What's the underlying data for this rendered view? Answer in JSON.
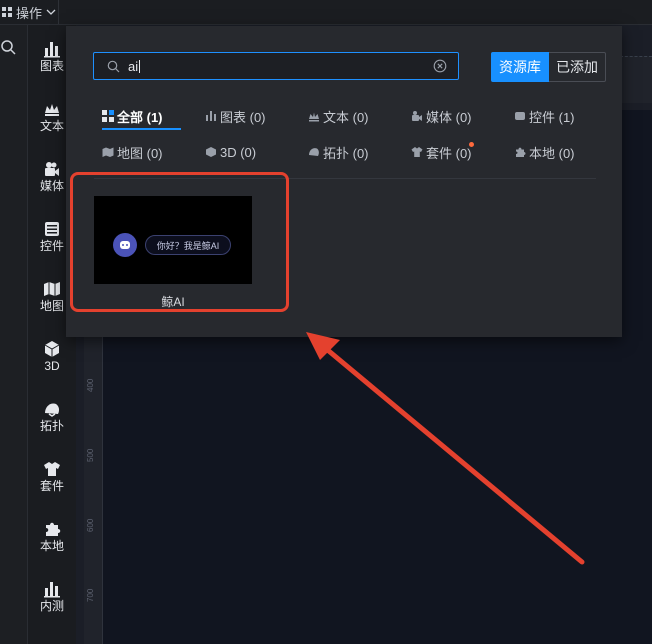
{
  "topbar": {
    "menu_label": "操作"
  },
  "rail": {
    "items": [
      {
        "label": "图表",
        "icon": "bar-chart-icon"
      },
      {
        "label": "文本",
        "icon": "crown-text-icon"
      },
      {
        "label": "媒体",
        "icon": "video-camera-icon"
      },
      {
        "label": "控件",
        "icon": "control-list-icon"
      },
      {
        "label": "地图",
        "icon": "map-icon"
      },
      {
        "label": "3D",
        "icon": "cube-icon"
      },
      {
        "label": "拓扑",
        "icon": "topology-icon"
      },
      {
        "label": "套件",
        "icon": "shirt-icon"
      },
      {
        "label": "本地",
        "icon": "puzzle-icon"
      },
      {
        "label": "内测",
        "icon": "bar-chart-icon"
      }
    ]
  },
  "ruler": {
    "labels": [
      "400",
      "500",
      "600",
      "700"
    ]
  },
  "panel": {
    "search": {
      "value": "ai"
    },
    "buttons": {
      "library": "资源库",
      "added": "已添加"
    },
    "categories": [
      {
        "label": "全部 (1)",
        "icon": "grid-icon"
      },
      {
        "label": "图表 (0)",
        "icon": "bar-chart-icon"
      },
      {
        "label": "文本 (0)",
        "icon": "crown-text-icon"
      },
      {
        "label": "媒体 (0)",
        "icon": "media-icon"
      },
      {
        "label": "控件 (1)",
        "icon": "control-icon"
      },
      {
        "label": "地图 (0)",
        "icon": "map-icon"
      },
      {
        "label": "3D (0)",
        "icon": "cube-icon"
      },
      {
        "label": "拓扑 (0)",
        "icon": "topology-icon"
      },
      {
        "label": "套件 (0)",
        "icon": "shirt-icon"
      },
      {
        "label": "本地 (0)",
        "icon": "puzzle-icon"
      }
    ],
    "results": [
      {
        "label": "鲸AI",
        "preview_text": "你好？我是鲸AI"
      }
    ]
  },
  "colors": {
    "accent": "#1890ff",
    "annotation": "#e4412e",
    "notify_dot": "#ff6a3d"
  }
}
